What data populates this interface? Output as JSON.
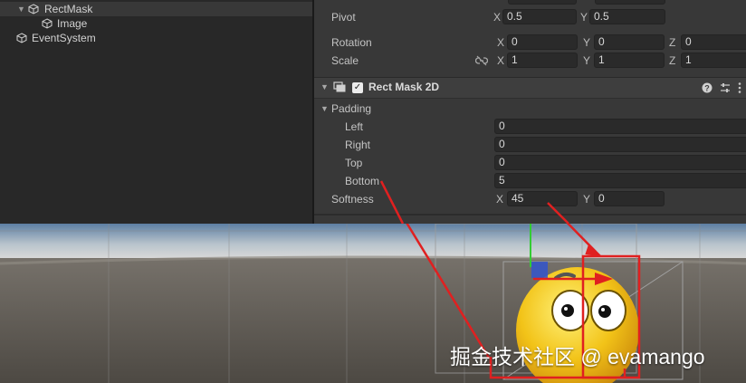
{
  "hierarchy": {
    "items": [
      {
        "label": "RectMask",
        "expanded": true,
        "selected": true
      },
      {
        "label": "Image"
      },
      {
        "label": "EventSystem"
      }
    ]
  },
  "inspector": {
    "pivot": {
      "label": "Pivot",
      "x_axis": "X",
      "x": "0.5",
      "y_axis": "Y",
      "y": "0.5"
    },
    "rotation": {
      "label": "Rotation",
      "x_axis": "X",
      "x": "0",
      "y_axis": "Y",
      "y": "0",
      "z_axis": "Z",
      "z": "0"
    },
    "scale": {
      "label": "Scale",
      "x_axis": "X",
      "x": "1",
      "y_axis": "Y",
      "y": "1",
      "z_axis": "Z",
      "z": "1"
    },
    "component": {
      "title": "Rect Mask 2D",
      "enabled": true
    },
    "padding": {
      "label": "Padding",
      "left_label": "Left",
      "left": "0",
      "right_label": "Right",
      "right": "0",
      "top_label": "Top",
      "top": "0",
      "bottom_label": "Bottom",
      "bottom": "5"
    },
    "softness": {
      "label": "Softness",
      "x_axis": "X",
      "x": "45",
      "y_axis": "Y",
      "y": "0"
    }
  },
  "watermark": "掘金技术社区 @ evamango",
  "colors": {
    "annotation": "#e02020",
    "gizmo_green": "#33cc33",
    "gizmo_blue": "#3355cc",
    "emoji_yellow": "#f2c318"
  }
}
